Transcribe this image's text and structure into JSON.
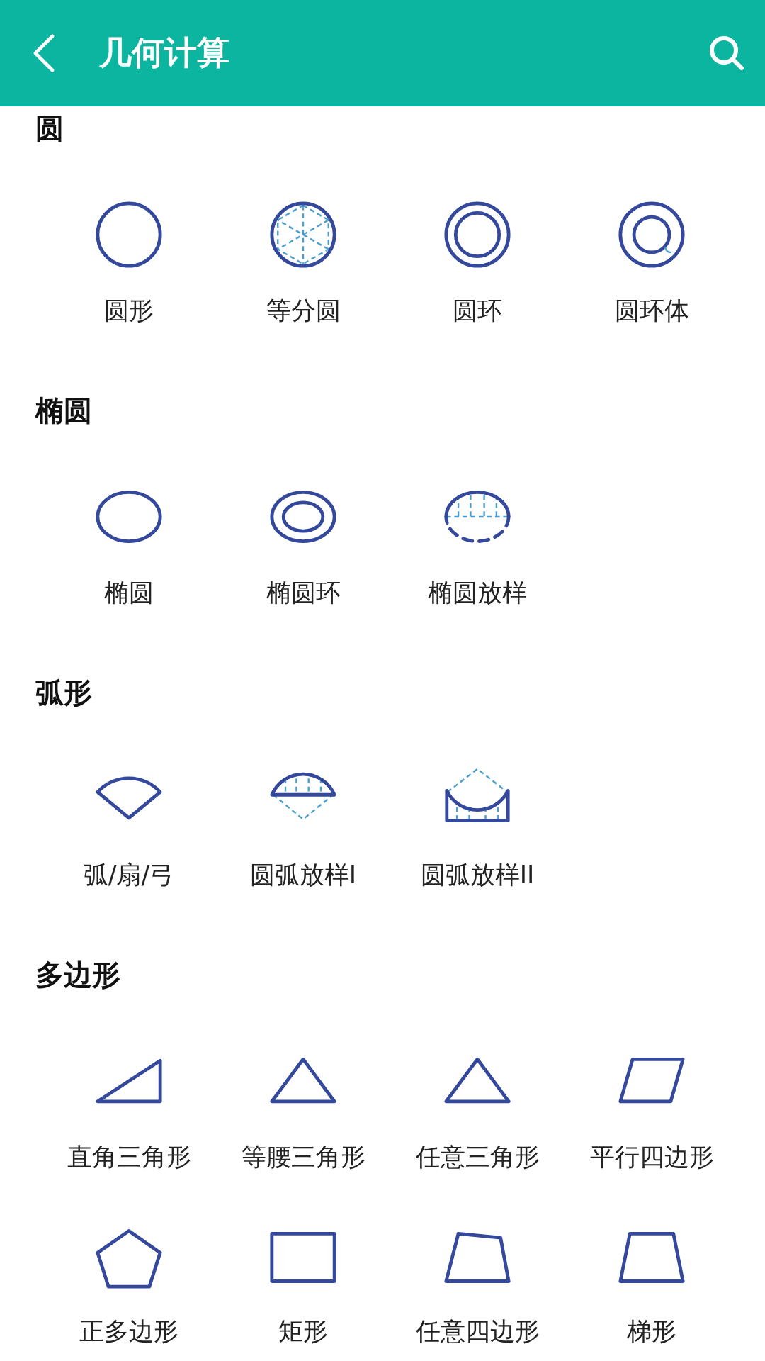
{
  "header": {
    "title": "几何计算"
  },
  "sections": [
    {
      "title": "圆",
      "items": [
        {
          "label": "圆形",
          "kind": "circle"
        },
        {
          "label": "等分圆",
          "kind": "divided-circle"
        },
        {
          "label": "圆环",
          "kind": "ring"
        },
        {
          "label": "圆环体",
          "kind": "torus"
        }
      ]
    },
    {
      "title": "椭圆",
      "items": [
        {
          "label": "椭圆",
          "kind": "ellipse"
        },
        {
          "label": "椭圆环",
          "kind": "ellipse-ring"
        },
        {
          "label": "椭圆放样",
          "kind": "ellipse-layout"
        }
      ]
    },
    {
      "title": "弧形",
      "items": [
        {
          "label": "弧/扇/弓",
          "kind": "sector"
        },
        {
          "label": "圆弧放样I",
          "kind": "arc-layout"
        },
        {
          "label": "圆弧放样II",
          "kind": "arc-layout-2"
        }
      ]
    },
    {
      "title": "多边形",
      "items": [
        {
          "label": "直角三角形",
          "kind": "right-triangle"
        },
        {
          "label": "等腰三角形",
          "kind": "isosceles-triangle"
        },
        {
          "label": "任意三角形",
          "kind": "triangle"
        },
        {
          "label": "平行四边形",
          "kind": "parallelogram"
        },
        {
          "label": "正多边形",
          "kind": "pentagon"
        },
        {
          "label": "矩形",
          "kind": "rectangle"
        },
        {
          "label": "任意四边形",
          "kind": "quadrilateral"
        },
        {
          "label": "梯形",
          "kind": "trapezoid"
        }
      ]
    }
  ]
}
